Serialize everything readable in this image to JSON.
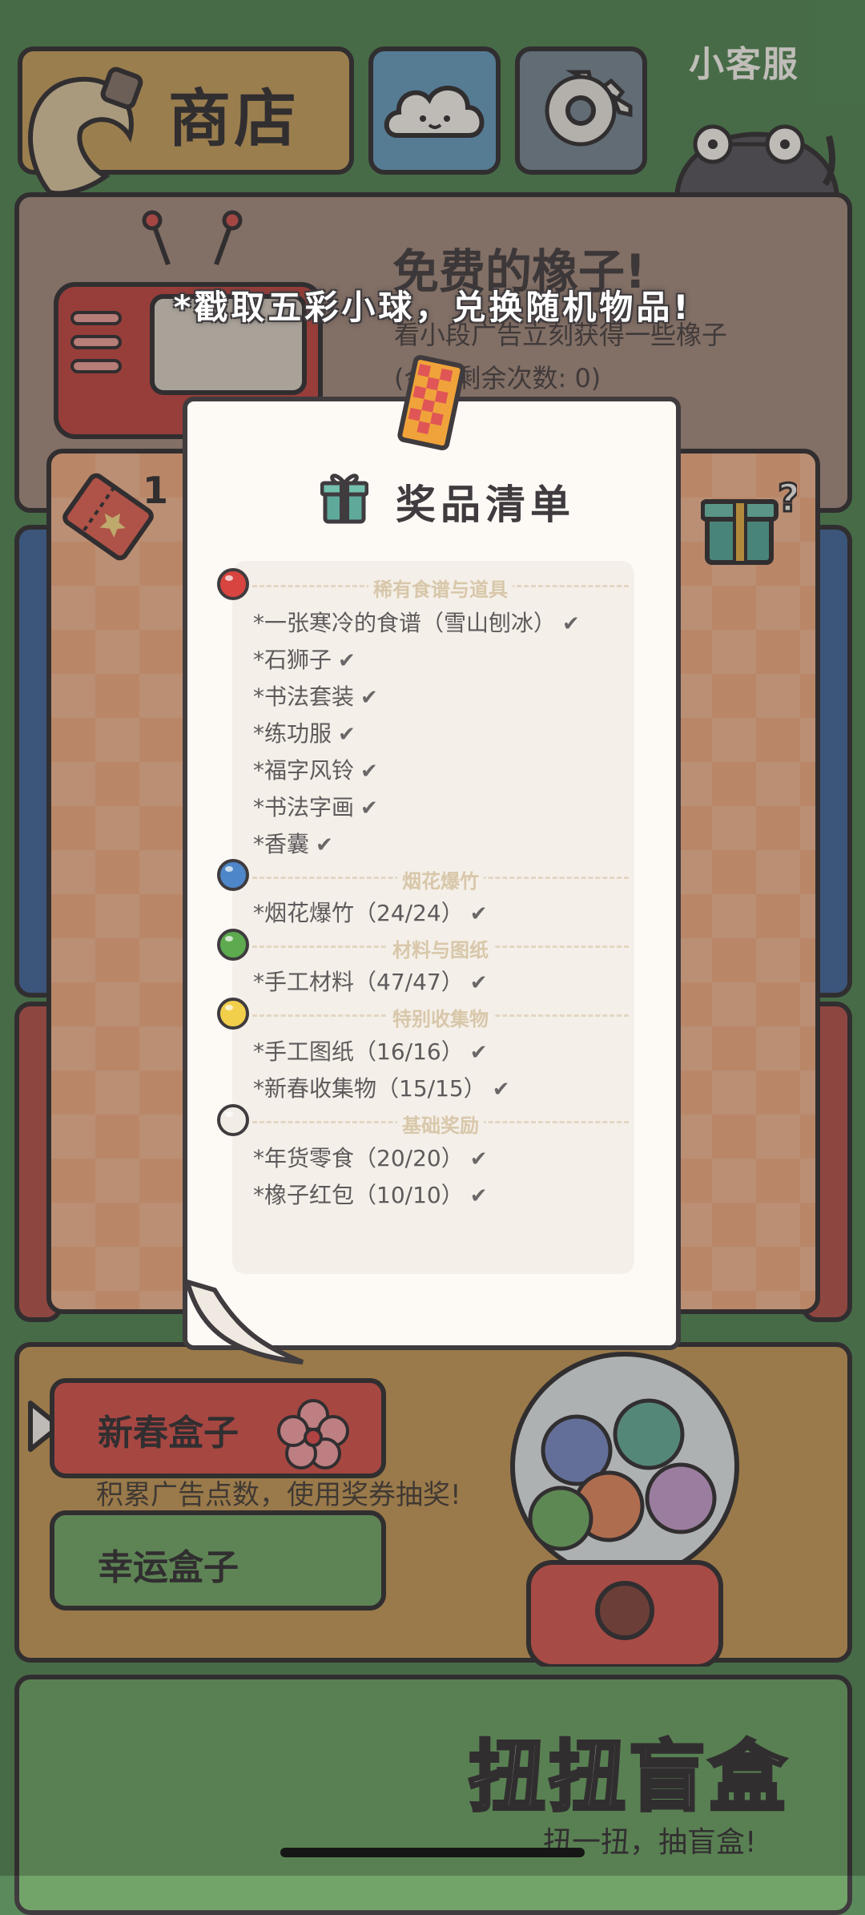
{
  "top_bar": {
    "shop_label": "商店",
    "service_label": "小客服"
  },
  "free_panel": {
    "title": "免费的橡子!",
    "subtitle": "看小段广告立刻获得一些橡子",
    "remaining": "(今日剩余次数: 0)"
  },
  "board": {
    "ticket_count": "1"
  },
  "box_panel": {
    "newyear_label": "新春盒子",
    "ad_tip": "积累广告点数，使用奖券抽奖!",
    "lucky_label": "幸运盒子"
  },
  "blind_panel": {
    "title": "扭扭盲盒",
    "subtitle": "扭一扭，抽盲盒!"
  },
  "overlay": {
    "banner": "*戳取五彩小球，兑换随机物品!",
    "prize_title": "奖品清单",
    "sections": [
      {
        "label": "稀有食谱与道具",
        "ball_color": "#d8443f",
        "items": [
          "*一张寒冷的食谱（雪山刨冰）",
          "*石狮子",
          "*书法套装",
          "*练功服",
          "*福字风铃",
          "*书法字画",
          "*香囊"
        ]
      },
      {
        "label": "烟花爆竹",
        "ball_color": "#4d86c9",
        "items": [
          "*烟花爆竹（24/24）"
        ]
      },
      {
        "label": "材料与图纸",
        "ball_color": "#5daa4f",
        "items": [
          "*手工材料（47/47）"
        ]
      },
      {
        "label": "特别收集物",
        "ball_color": "#f2cf4b",
        "items": [
          "*手工图纸（16/16）",
          "*新春收集物（15/15）"
        ]
      },
      {
        "label": "基础奖励",
        "ball_color": "#f1ece6",
        "items": [
          "*年货零食（20/20）",
          "*橡子红包（10/10）"
        ]
      }
    ],
    "check_mark": "✔"
  },
  "colors": {
    "outline": "#3f3b3e",
    "paper": "#fdfaf6",
    "background": "#5b8a5c"
  }
}
